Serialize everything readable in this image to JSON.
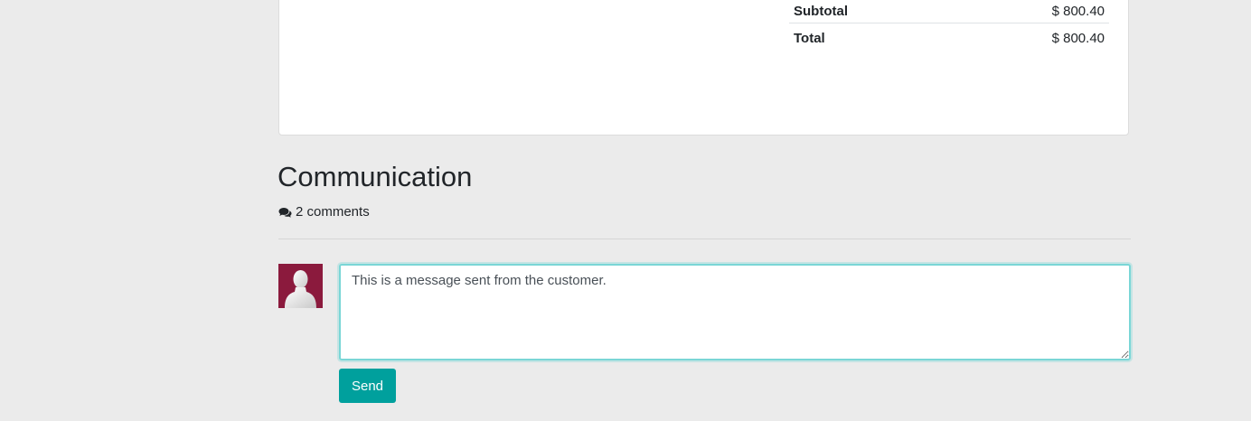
{
  "totals": {
    "subtotal_label": "Subtotal",
    "subtotal_value": "$ 800.40",
    "total_label": "Total",
    "total_value": "$ 800.40"
  },
  "communication": {
    "title": "Communication",
    "comments_count": "2 comments",
    "comments_icon": "comments-icon"
  },
  "composer": {
    "avatar_icon": "user-avatar-icon",
    "message_value": "This is a message sent from the customer.",
    "send_label": "Send"
  },
  "colors": {
    "accent": "#00a09d",
    "avatar_bg": "#8b1a3d",
    "textarea_focus": "#7ad6d6",
    "page_bg": "#ebebeb"
  }
}
